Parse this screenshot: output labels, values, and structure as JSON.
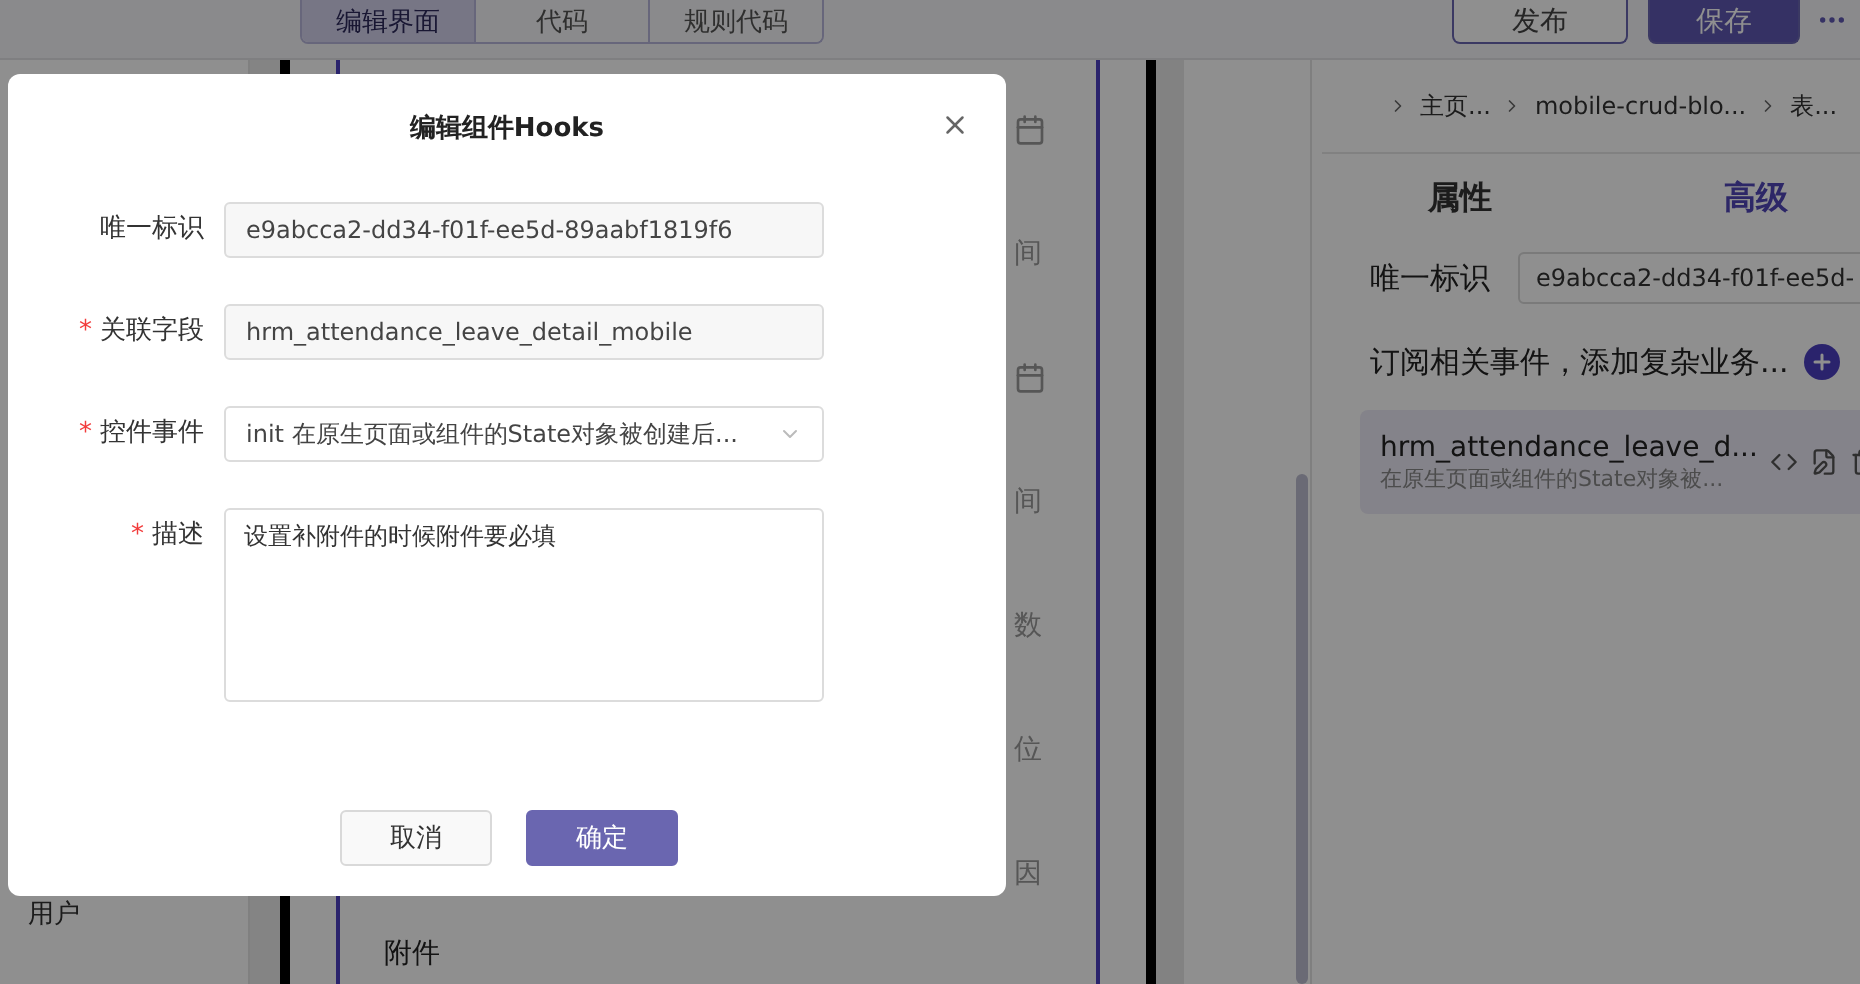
{
  "top_bar": {
    "tabs": [
      {
        "label": "编辑界面",
        "selected": true
      },
      {
        "label": "代码",
        "selected": false
      },
      {
        "label": "规则代码",
        "selected": false
      }
    ],
    "buttons": [
      {
        "label": "发布",
        "kind": "outline"
      },
      {
        "label": "保存",
        "kind": "primary"
      }
    ]
  },
  "sidebar": {
    "text": "用户"
  },
  "canvas": {
    "rows": [
      {
        "kind": "date"
      },
      {
        "kind": "text",
        "label": "间"
      },
      {
        "kind": "date"
      },
      {
        "kind": "text",
        "label": "间"
      },
      {
        "kind": "text",
        "label": "数"
      },
      {
        "kind": "text",
        "label": "位"
      },
      {
        "kind": "text",
        "label": "因"
      }
    ],
    "footer_label": "附件"
  },
  "property_panel": {
    "breadcrumbs": [
      "主页...",
      "mobile-crud-blo...",
      "表..."
    ],
    "tabs": [
      {
        "label": "属性",
        "selected": false
      },
      {
        "label": "高级",
        "selected": true
      }
    ],
    "id_field": {
      "label": "唯一标识",
      "value": "e9abcca2-dd34-f01f-ee5d-"
    },
    "events_hint": "订阅相关事件，添加复杂业务...",
    "hooks": [
      {
        "name": "hrm_attendance_leave_d...",
        "description": "在原生页面或组件的State对象被..."
      }
    ]
  },
  "dialog": {
    "title": "编辑组件Hooks",
    "fields": [
      {
        "kind": "input",
        "label": "唯一标识",
        "value": "e9abcca2-dd34-f01f-ee5d-89aabf1819f6"
      },
      {
        "kind": "input",
        "label": "关联字段",
        "required_mark": "*",
        "value": "hrm_attendance_leave_detail_mobile"
      },
      {
        "kind": "select",
        "label": "控件事件",
        "required_mark": "*",
        "value": "init 在原生页面或组件的State对象被创建后..."
      },
      {
        "kind": "textarea",
        "label": "描述",
        "required_mark": "*",
        "value": "设置补附件的时候附件要必填"
      }
    ],
    "buttons": [
      {
        "label": "取消",
        "kind": "default"
      },
      {
        "label": "确定",
        "kind": "primary"
      }
    ]
  }
}
